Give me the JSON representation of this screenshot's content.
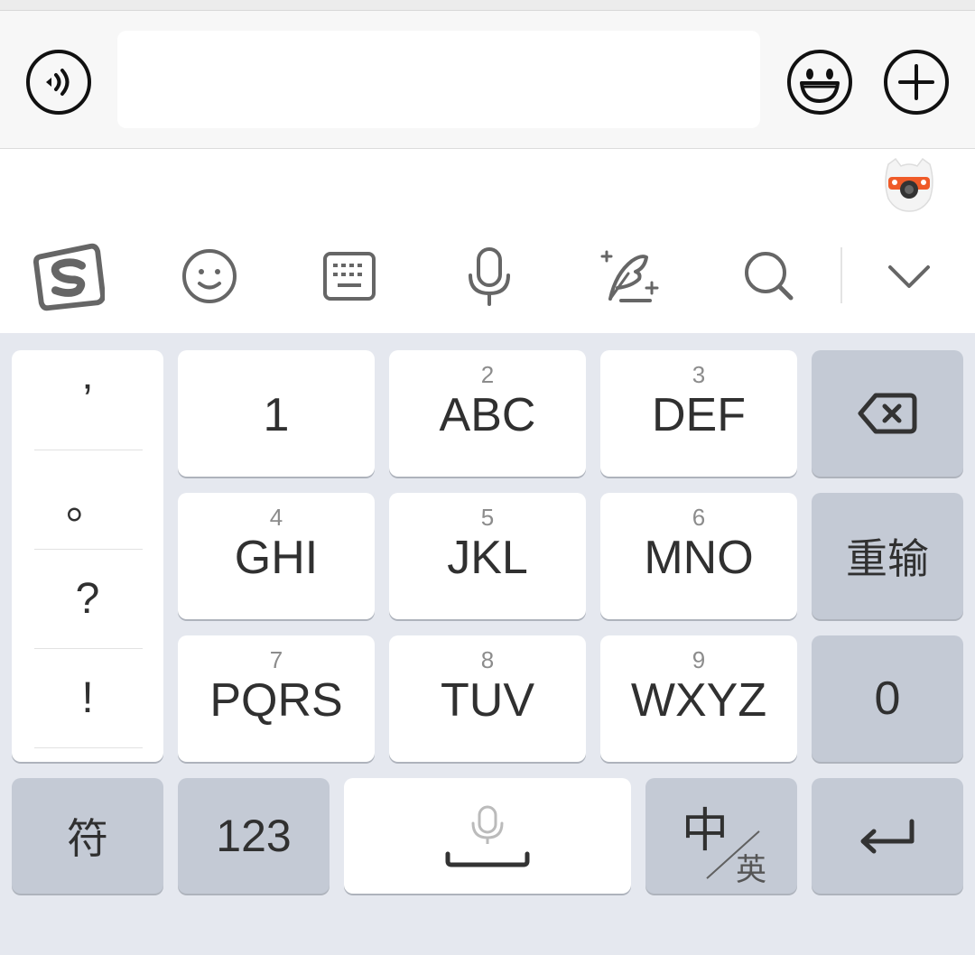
{
  "chat": {
    "input_value": "",
    "voice_icon": "voice-wave-icon",
    "emoji_icon": "smiley-icon",
    "plus_icon": "plus-icon"
  },
  "toolbar": {
    "items": [
      {
        "name": "sogou-logo-icon"
      },
      {
        "name": "emoji-icon"
      },
      {
        "name": "keyboard-icon"
      },
      {
        "name": "microphone-icon"
      },
      {
        "name": "handwriting-icon"
      },
      {
        "name": "search-icon"
      },
      {
        "name": "collapse-icon"
      }
    ],
    "mascot": "mascot-avatar-icon"
  },
  "keyboard": {
    "punctuation": [
      "’",
      "。",
      "?",
      "!"
    ],
    "keys": {
      "k1": {
        "num": "",
        "letters": "1"
      },
      "k2": {
        "num": "2",
        "letters": "ABC"
      },
      "k3": {
        "num": "3",
        "letters": "DEF"
      },
      "k4": {
        "num": "4",
        "letters": "GHI"
      },
      "k5": {
        "num": "5",
        "letters": "JKL"
      },
      "k6": {
        "num": "6",
        "letters": "MNO"
      },
      "k7": {
        "num": "7",
        "letters": "PQRS"
      },
      "k8": {
        "num": "8",
        "letters": "TUV"
      },
      "k9": {
        "num": "9",
        "letters": "WXYZ"
      }
    },
    "reinput_label": "重输",
    "zero_label": "0",
    "symbol_label": "符",
    "numbers_label": "123",
    "lang_main": "中",
    "lang_sub": "英",
    "colors": {
      "background": "#e5e8ef",
      "key": "#ffffff",
      "function_key": "#c4cad5",
      "text": "#303030"
    }
  }
}
